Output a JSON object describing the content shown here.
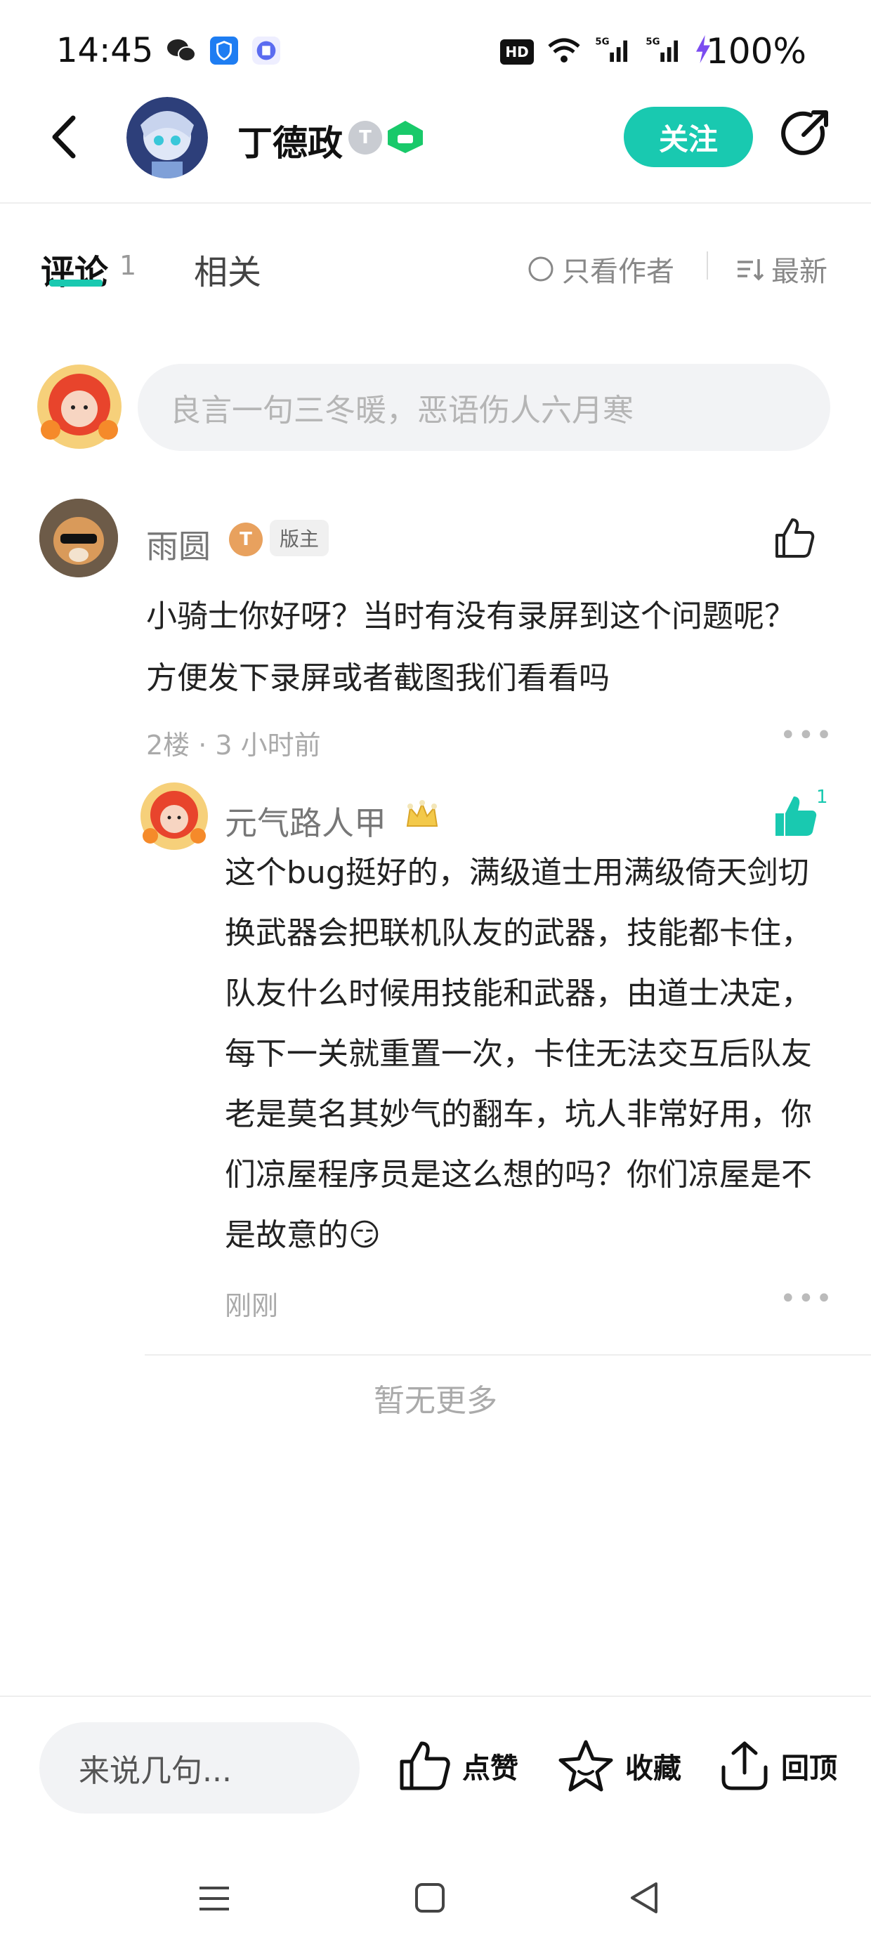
{
  "status_bar": {
    "time": "14:45",
    "network": "5G",
    "hd_label": "HD",
    "battery": "100%"
  },
  "header": {
    "user_name": "丁德政",
    "level_badge": "T",
    "follow_label": "关注"
  },
  "tabs": {
    "comments_label": "评论",
    "comments_count": "1",
    "related_label": "相关",
    "author_only_label": "只看作者",
    "sort_label": "最新"
  },
  "comment_input": {
    "placeholder": "良言一句三冬暖，恶语伤人六月寒"
  },
  "comments": [
    {
      "author": "雨圆",
      "level_badge": "T",
      "role_badge": "版主",
      "text": "小骑士你好呀？当时有没有录屏到这个问题呢？方便发下录屏或者截图我们看看吗",
      "meta": "2楼 · 3 小时前",
      "reply": {
        "author": "元气路人甲",
        "like_count": "1",
        "text": "这个bug挺好的，满级道士用满级倚天剑切换武器会把联机队友的武器，技能都卡住，队友什么时候用技能和武器，由道士决定，每下一关就重置一次，卡住无法交互后队友老是莫名其妙气的翻车，坑人非常好用，你们凉屋程序员是这么想的吗？你们凉屋是不是故意的😏",
        "meta": "刚刚"
      }
    }
  ],
  "no_more_label": "暂无更多",
  "bottom_bar": {
    "input_placeholder": "来说几句...",
    "like_label": "点赞",
    "favorite_label": "收藏",
    "top_label": "回顶"
  },
  "colors": {
    "accent": "#19c9b0",
    "muted_text": "#aaaaaa"
  }
}
